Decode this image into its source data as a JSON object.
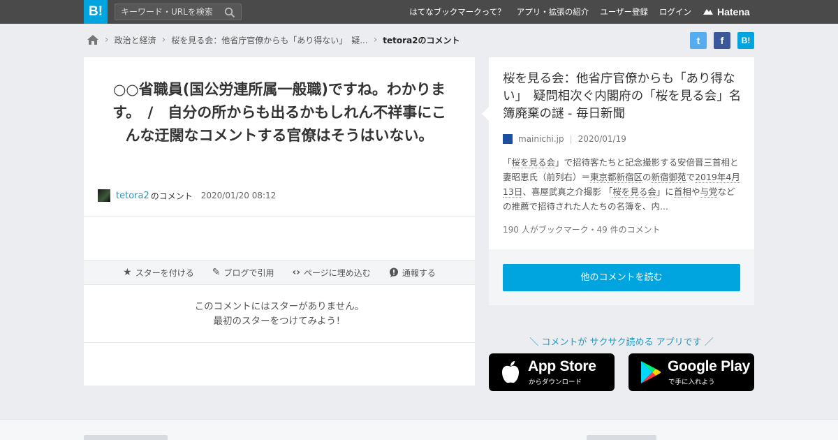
{
  "header": {
    "logo_text": "B!",
    "search": {
      "placeholder": "キーワード・URLを検索"
    },
    "nav": [
      {
        "label": "はてなブックマークって？"
      },
      {
        "label": "アプリ・拡張の紹介"
      },
      {
        "label": "ユーザー登録"
      },
      {
        "label": "ログイン"
      }
    ],
    "hatena_label": "Hatena"
  },
  "breadcrumb": {
    "items": [
      {
        "label": "政治と経済"
      },
      {
        "label": "桜を見る会：他省庁官僚からも「あり得ない」　疑..."
      }
    ],
    "current": "tetora2のコメント"
  },
  "share": {
    "twitter": "t",
    "facebook": "f",
    "hatebu": "B!"
  },
  "comment": {
    "text": "○○省職員(国公労連所属一般職)ですね。わかります。　/　自分の所からも出るかもしれん不祥事にこんな迂闊なコメントする官僚はそうはいない。",
    "user": "tetora2",
    "user_suffix": "のコメント",
    "date": "2020/01/20 08:12"
  },
  "actions": [
    {
      "label": "スターを付ける",
      "icon": "star-icon"
    },
    {
      "label": "ブログで引用",
      "icon": "pencil-icon"
    },
    {
      "label": "ページに埋め込む",
      "icon": "code-icon"
    },
    {
      "label": "通報する",
      "icon": "alert-icon"
    }
  ],
  "stars": {
    "line1": "このコメントにはスターがありません。",
    "line2": "最初のスターをつけてみよう！"
  },
  "article": {
    "title": "桜を見る会：他省庁官僚からも「あり得ない」　疑問相次ぐ内閣府の「桜を見る会」名簿廃棄の謎 - 毎日新聞",
    "domain": "mainichi.jp",
    "date": "2020/01/19",
    "desc": {
      "p1": "「",
      "l1": "桜を見る会",
      "p2": "」で招待客たちと記念撮影する安倍晋三首相と妻昭恵氏（前列右）＝",
      "l2": "東京都新宿区",
      "p3": "の",
      "l3": "新宿御苑",
      "p4": "で",
      "l4": "2019年4月13日",
      "p5": "、喜屋武真之介撮影 「",
      "l5": "桜を見る会",
      "p6": "」に",
      "l6": "首相",
      "p7": "や",
      "l7": "与党",
      "p8": "などの推薦で招待された人たちの名簿を、内..."
    },
    "stats": "190 人がブックマーク・49 件のコメント",
    "more_button": "他のコメントを読む"
  },
  "promo": {
    "text": "＼ コメントが サクサク読める アプリです ／",
    "apple_big": "App Store",
    "apple_small": "からダウンロード",
    "google_big": "Google Play",
    "google_small": "で手に入れよう"
  },
  "colors": {
    "accent": "#00a4de",
    "topbar": "#4a4a4a",
    "link": "#2198bf"
  }
}
